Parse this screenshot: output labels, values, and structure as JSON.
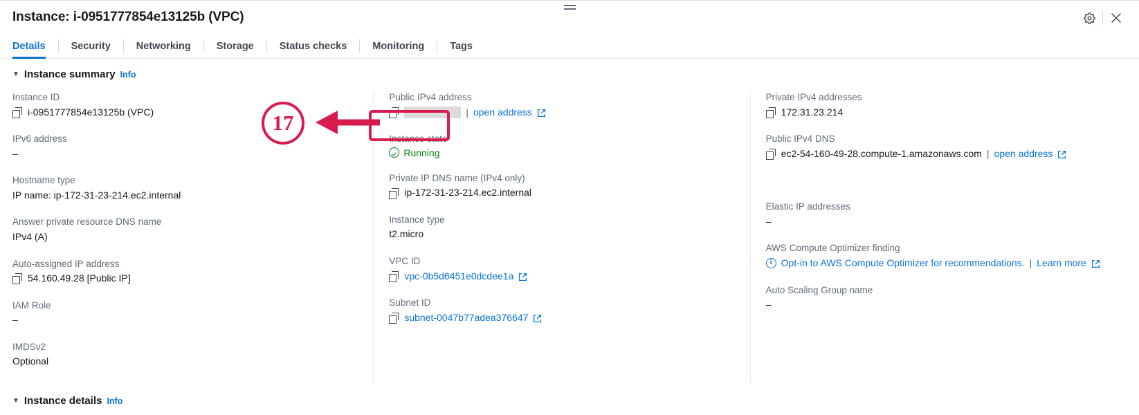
{
  "header": {
    "title": "Instance: i-0951777854e13125b (VPC)",
    "settings_icon": "gear-icon",
    "close_icon": "close-icon",
    "drag_handle": "drag-handle"
  },
  "tabs": [
    {
      "label": "Details",
      "active": true
    },
    {
      "label": "Security",
      "active": false
    },
    {
      "label": "Networking",
      "active": false
    },
    {
      "label": "Storage",
      "active": false
    },
    {
      "label": "Status checks",
      "active": false
    },
    {
      "label": "Monitoring",
      "active": false
    },
    {
      "label": "Tags",
      "active": false
    }
  ],
  "sections": {
    "summary": {
      "title": "Instance summary",
      "info": "Info",
      "caret": "▼"
    },
    "details": {
      "title": "Instance details",
      "info": "Info",
      "caret": "▼"
    }
  },
  "columns": {
    "left": [
      {
        "label": "Instance ID",
        "value": "i-0951777854e13125b (VPC)",
        "copy": true
      },
      {
        "label": "IPv6 address",
        "value": "–",
        "copy": false
      },
      {
        "label": "Hostname type",
        "value": "IP name: ip-172-31-23-214.ec2.internal",
        "copy": false
      },
      {
        "label": "Answer private resource DNS name",
        "value": "IPv4 (A)",
        "copy": false
      },
      {
        "label": "Auto-assigned IP address",
        "value": "54.160.49.28 [Public IP]",
        "copy": true
      },
      {
        "label": "IAM Role",
        "value": "–",
        "copy": false
      },
      {
        "label": "IMDSv2",
        "value": "Optional",
        "copy": false
      }
    ],
    "middle": [
      {
        "label": "Public IPv4 address",
        "value": "",
        "redacted": true,
        "copy": true,
        "link": "open address",
        "external": true
      },
      {
        "label": "Instance state",
        "value": "Running",
        "status": "running"
      },
      {
        "label": "Private IP DNS name (IPv4 only)",
        "value": "ip-172-31-23-214.ec2.internal",
        "copy": true
      },
      {
        "label": "Instance type",
        "value": "t2.micro",
        "copy": false
      },
      {
        "label": "VPC ID",
        "value": "vpc-0b5d6451e0dcdee1a",
        "copy": true,
        "is_link": true,
        "external": true
      },
      {
        "label": "Subnet ID",
        "value": "subnet-0047b77adea376647",
        "copy": true,
        "is_link": true,
        "external": true
      }
    ],
    "right": [
      {
        "label": "Private IPv4 addresses",
        "value": "172.31.23.214",
        "copy": true
      },
      {
        "label": "Public IPv4 DNS",
        "value": "ec2-54-160-49-28.compute-1.amazonaws.com",
        "copy": true,
        "link": "open address",
        "external": true
      },
      {
        "label": "Elastic IP addresses",
        "value": "–",
        "copy": false
      },
      {
        "label": "AWS Compute Optimizer finding",
        "value": "Opt-in to AWS Compute Optimizer for recommendations.",
        "info_icon": true,
        "is_link": true,
        "secondary_link": "Learn more",
        "external": true
      },
      {
        "label": "Auto Scaling Group name",
        "value": "–",
        "copy": false
      }
    ]
  },
  "annotation": {
    "number": "17",
    "color": "#d81b4f",
    "target": "public-ipv4-address-field"
  },
  "colors": {
    "accent": "#0972d3",
    "success": "#037f0c",
    "label": "#5f6b7a",
    "text": "#16191f",
    "annotation": "#d81b4f"
  }
}
